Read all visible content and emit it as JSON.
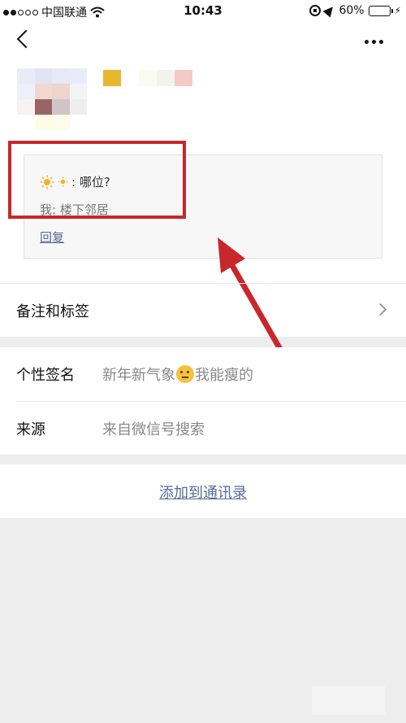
{
  "status_bar": {
    "carrier": "中国联通",
    "time": "10:43",
    "battery": "60%",
    "battery_level": 0.6
  },
  "greeting": {
    "question": ": 哪位?",
    "my_reply": "我: 楼下邻居",
    "reply_link": "回复"
  },
  "tags_row": {
    "label": "备注和标签"
  },
  "info": {
    "signature_label": "个性签名",
    "signature_text_before": "新年新气象",
    "signature_text_after": "我能瘦的",
    "source_label": "来源",
    "source_value": "来自微信号搜索"
  },
  "add_contact": {
    "label": "添加到通讯录"
  },
  "colors": {
    "link": "#576b95",
    "highlight": "#c8272b",
    "battery": "#4cd964"
  }
}
